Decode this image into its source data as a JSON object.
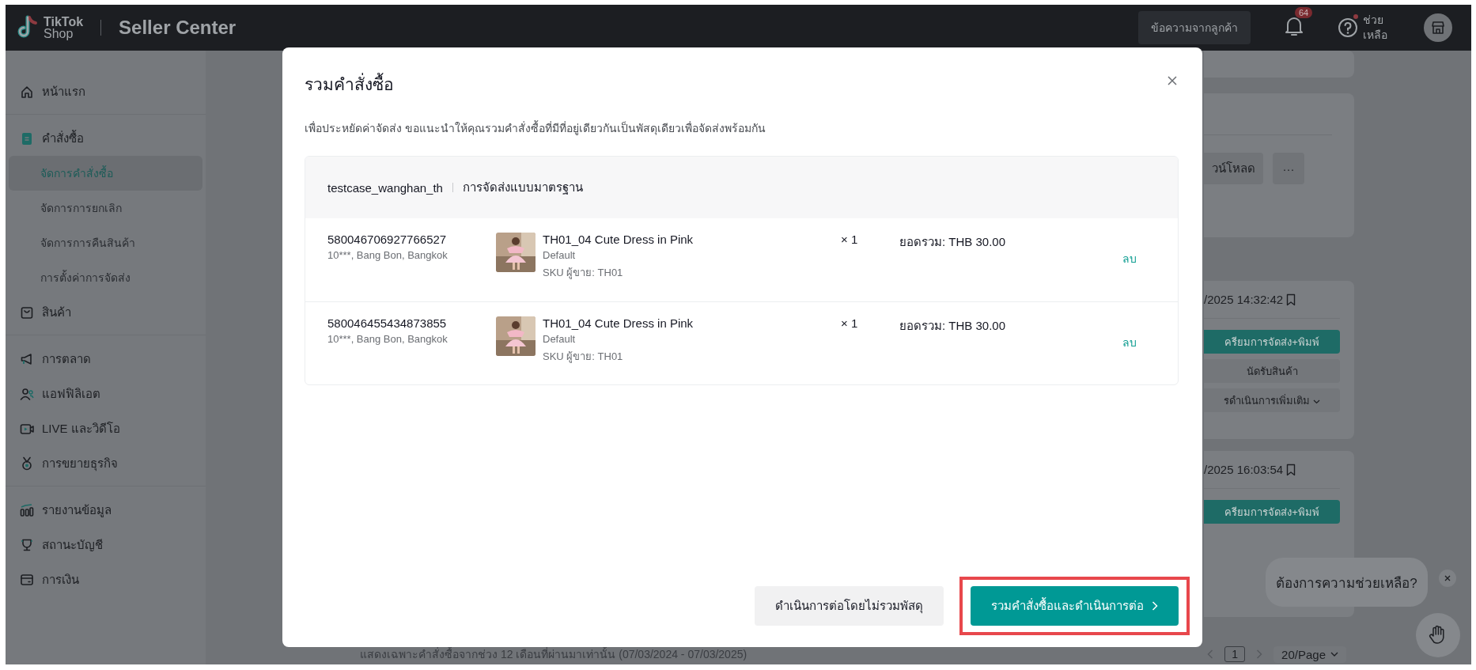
{
  "header": {
    "logo_top": "TikTok",
    "logo_bottom": "Shop",
    "product": "Seller Center",
    "messages_button": "ข้อความจากลูกค้า",
    "notification_count": "64",
    "help_lines": [
      "ช่วย",
      "เหลือ"
    ],
    "help_unread": true
  },
  "sidebar": {
    "groups": [
      {
        "items": [
          {
            "label": "หน้าแรก",
            "selected": false
          }
        ]
      },
      {
        "items": [
          {
            "label": "คำสั่งซื้อ",
            "selected": false,
            "children": [
              {
                "label": "จัดการคำสั่งซื้อ",
                "selected": true
              },
              {
                "label": "จัดการการยกเลิก",
                "selected": false
              },
              {
                "label": "จัดการการคืนสินค้า",
                "selected": false
              },
              {
                "label": "การตั้งค่าการจัดส่ง",
                "selected": false
              }
            ]
          },
          {
            "label": "สินค้า",
            "selected": false
          }
        ]
      },
      {
        "items": [
          {
            "label": "การตลาด",
            "selected": false
          },
          {
            "label": "แอฟฟิลิเอต",
            "selected": false
          },
          {
            "label": "LIVE และวิดีโอ",
            "selected": false
          },
          {
            "label": "การขยายธุรกิจ",
            "selected": false
          }
        ]
      },
      {
        "items": [
          {
            "label": "รายงานข้อมูล",
            "selected": false
          },
          {
            "label": "สถานะบัญชี",
            "selected": false
          },
          {
            "label": "การเงิน",
            "selected": false
          }
        ]
      }
    ]
  },
  "background": {
    "toolbar_buttons": [
      "วน์โหลด",
      "···"
    ],
    "orders": [
      {
        "time": "/2025 14:32:42",
        "actions": [
          {
            "label": "ครียมการจัดส่ง+พิมพ์",
            "kind": "primary"
          },
          {
            "label": "นัดรับสินค้า",
            "kind": "secondary"
          },
          {
            "label": "รดำเนินการเพิ่มเติม",
            "kind": "dropdown"
          }
        ]
      },
      {
        "time": "/2025 16:03:54",
        "actions": [
          {
            "label": "ครียมการจัดส่ง+พิมพ์",
            "kind": "primary"
          }
        ]
      }
    ],
    "footer_note": "แสดงเฉพาะคำสั่งซื้อจากช่วง 12 เดือนที่ผ่านมาเท่านั้น (07/03/2024 - 07/03/2025)",
    "pagination": {
      "current": "1",
      "page_size": "20/Page"
    }
  },
  "dialog": {
    "title": "รวมคำสั่งซื้อ",
    "description": "เพื่อประหยัดค่าจัดส่ง ขอแนะนำให้คุณรวมคำสั่งซื้อที่มีที่อยู่เดียวกันเป็นพัสดุเดียวเพื่อจัดส่งพร้อมกัน",
    "shop": "testcase_wanghan_th",
    "shipping": "การจัดส่งแบบมาตรฐาน",
    "orders": [
      {
        "order_id": "580046706927766527",
        "address": "10***, Bang Bon, Bangkok",
        "product": "TH01_04 Cute Dress in Pink",
        "variant": "Default",
        "sku": "SKU ผู้ขาย: TH01",
        "quantity": "× 1",
        "total": "ยอดรวม: THB 30.00",
        "remove": "ลบ"
      },
      {
        "order_id": "580046455434873855",
        "address": "10***, Bang Bon, Bangkok",
        "product": "TH01_04 Cute Dress in Pink",
        "variant": "Default",
        "sku": "SKU ผู้ขาย: TH01",
        "quantity": "× 1",
        "total": "ยอดรวม: THB 30.00",
        "remove": "ลบ"
      }
    ],
    "buttons": [
      {
        "label": "ดำเนินการต่อโดยไม่รวมพัสดุ",
        "kind": "secondary",
        "highlighted": false
      },
      {
        "label": "รวมคำสั่งซื้อและดำเนินการต่อ",
        "kind": "primary",
        "highlighted": true
      }
    ]
  },
  "help_bubble": {
    "text": "ต้องการความช่วยเหลือ?"
  }
}
